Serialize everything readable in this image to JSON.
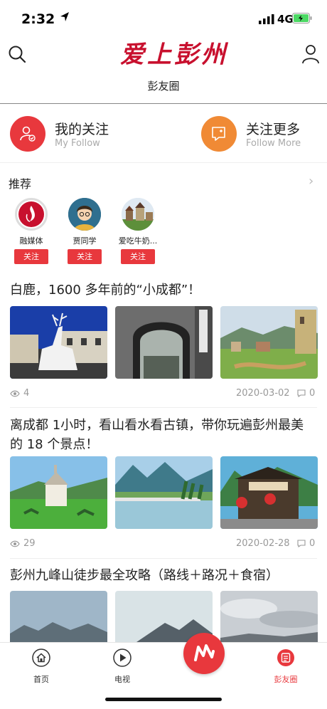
{
  "status_bar": {
    "time": "2:32",
    "network": "4G"
  },
  "header": {
    "logo_text": "爱上彭州",
    "subtitle": "彭友圈"
  },
  "follow": {
    "my_follow": {
      "title": "我的关注",
      "subtitle": "My Follow"
    },
    "follow_more": {
      "title": "关注更多",
      "subtitle": "Follow  More"
    }
  },
  "recommend": {
    "title": "推荐",
    "items": [
      {
        "name": "融媒体",
        "button": "关注"
      },
      {
        "name": "贾同学",
        "button": "关注"
      },
      {
        "name": "爱吃牛奶...",
        "button": "关注"
      }
    ]
  },
  "articles": [
    {
      "title": "白鹿，1600 多年前的“小成都”！",
      "views": "4",
      "date": "2020-03-02",
      "comments": "0"
    },
    {
      "title": "离成都 1小时，看山看水看古镇，带你玩遍彭州最美的 18 个景点！",
      "views": "29",
      "date": "2020-02-28",
      "comments": "0"
    },
    {
      "title": "彭州九峰山徒步最全攻略（路线＋路况＋食宿）"
    }
  ],
  "tabbar": {
    "home": "首页",
    "tv": "电视",
    "friends": "彭友圈"
  },
  "colors": {
    "accent": "#e8383d",
    "orange": "#f08a35"
  }
}
